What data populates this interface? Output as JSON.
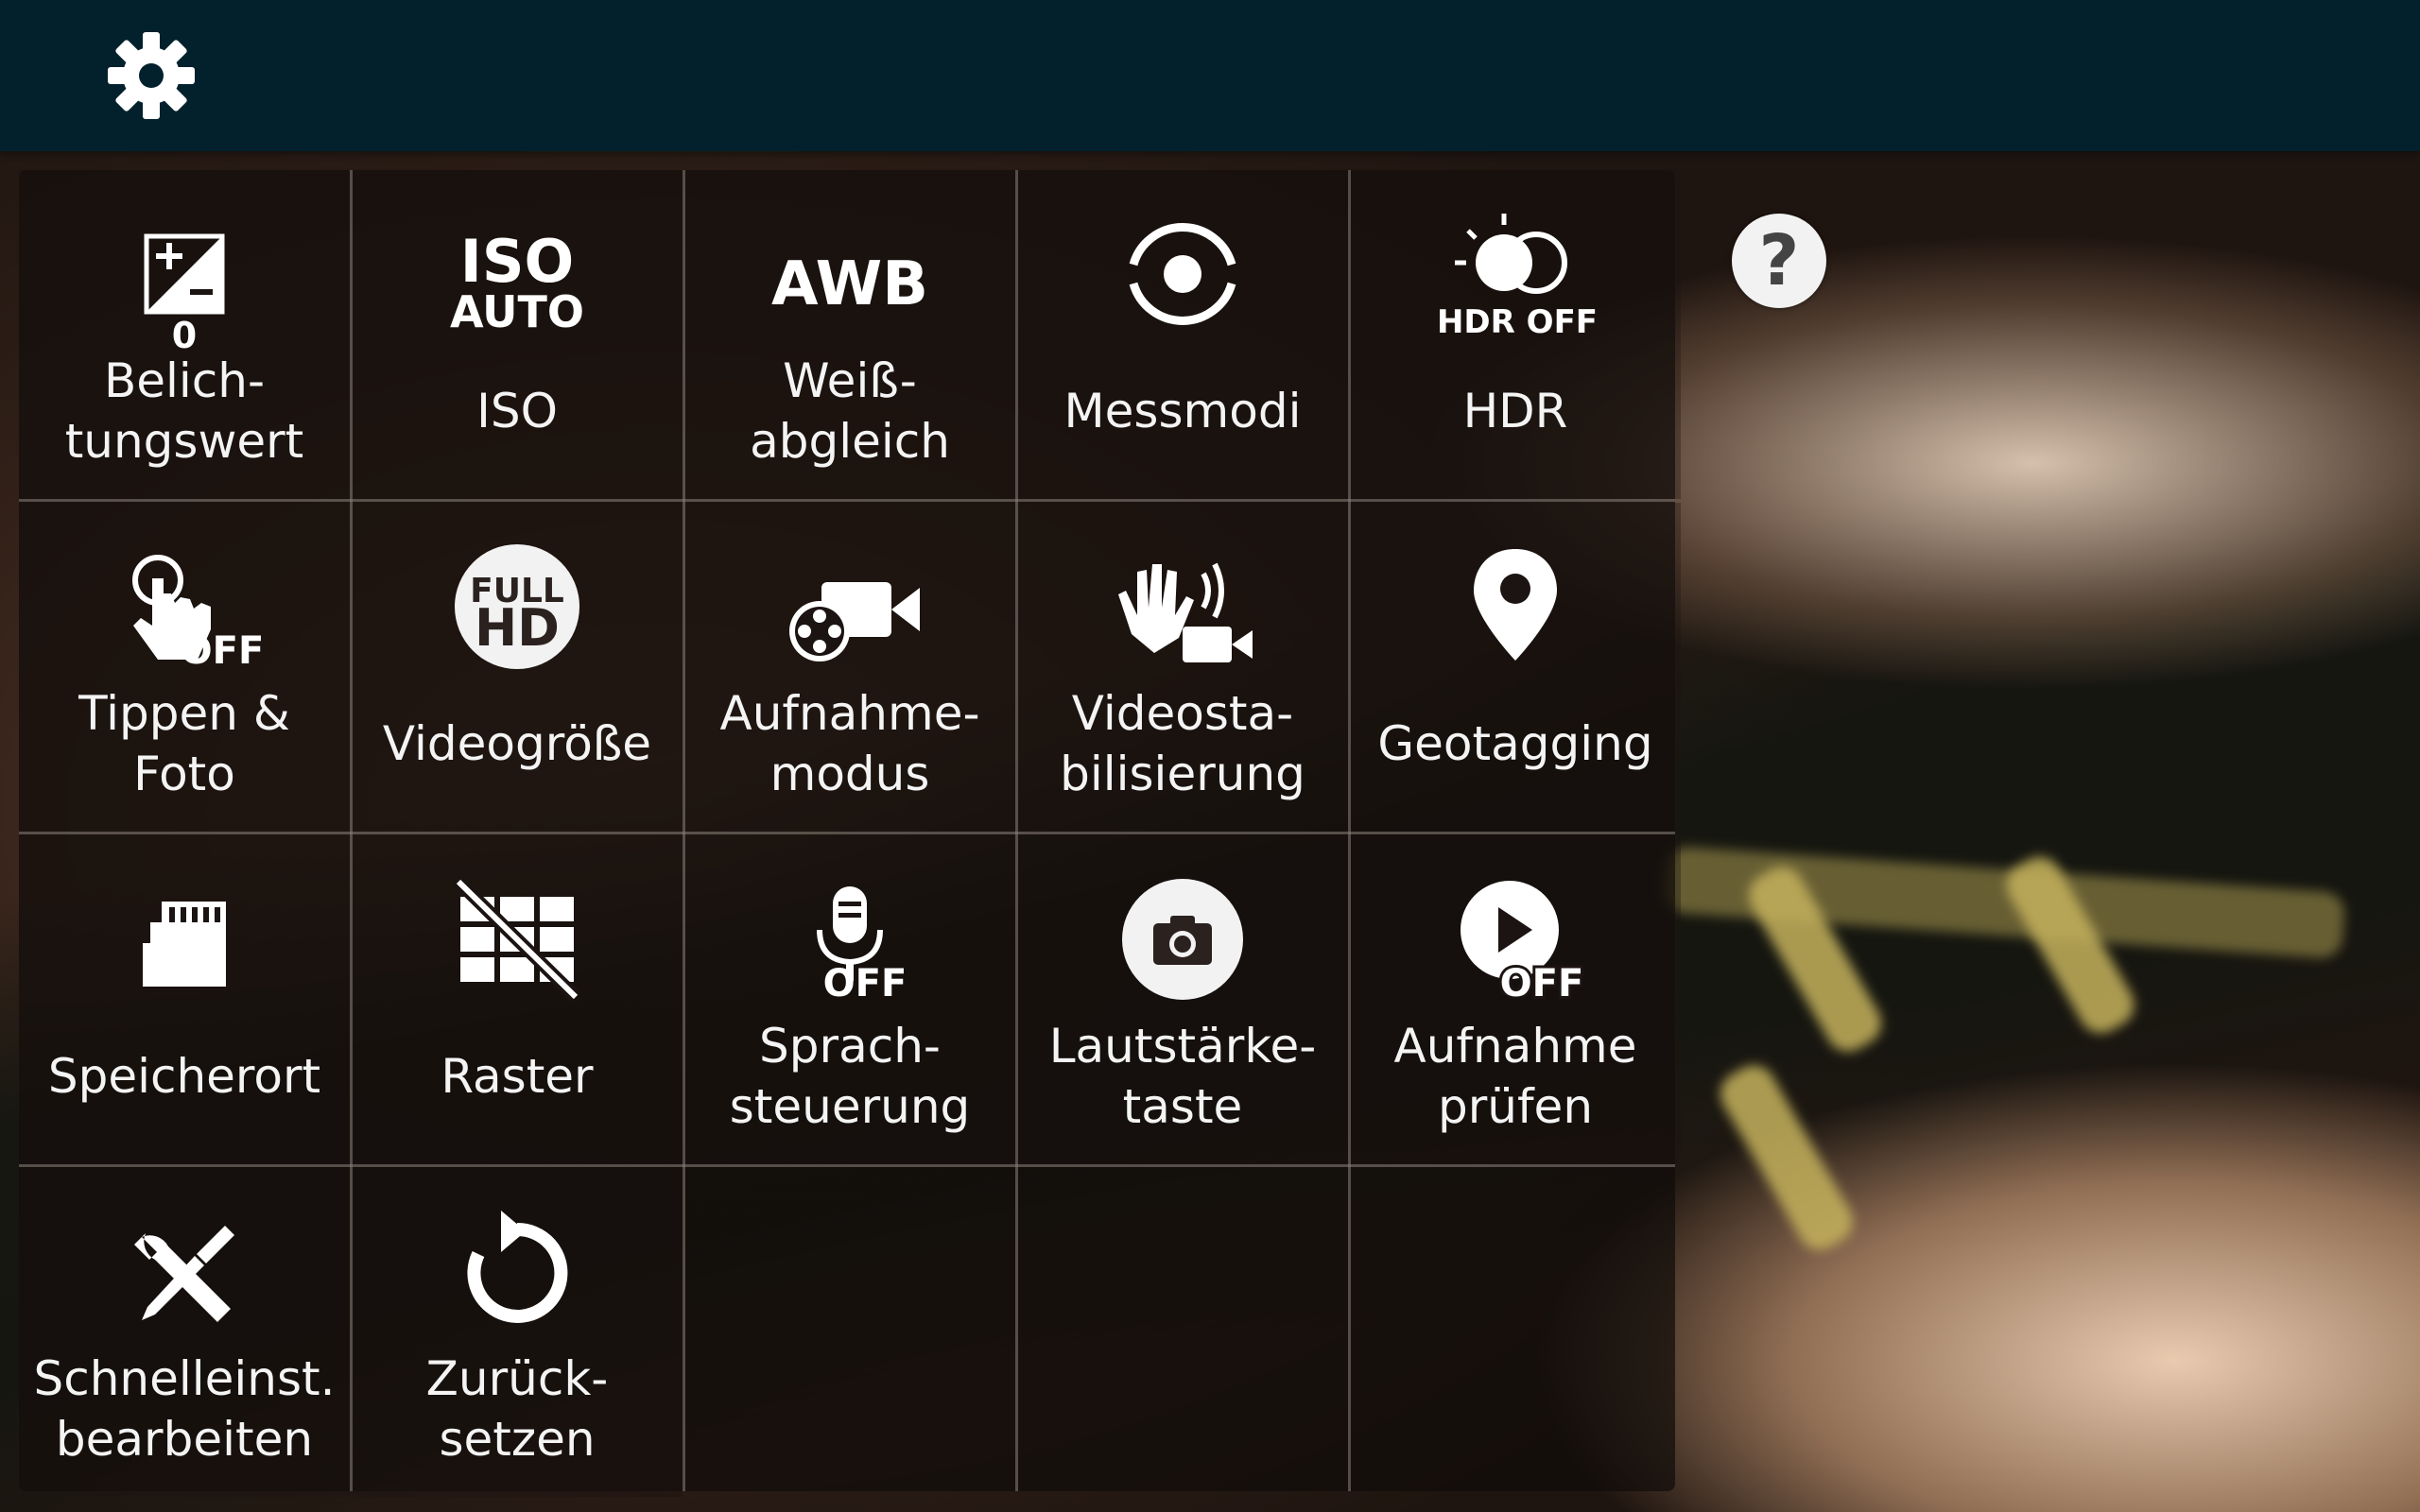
{
  "top_bar": {
    "settings_icon": "gear-icon"
  },
  "help": {
    "label": "?"
  },
  "menu": {
    "items": [
      {
        "key": "exposure",
        "icon": "exposure-value-icon",
        "value": "0",
        "label": "Belich-\ntungswert"
      },
      {
        "key": "iso",
        "icon": "iso-auto-icon",
        "icon_top": "ISO",
        "icon_bottom": "AUTO",
        "label": "ISO"
      },
      {
        "key": "wb",
        "icon": "awb-icon",
        "icon_text": "AWB",
        "label": "Weiß-\nabgleich"
      },
      {
        "key": "metering",
        "icon": "metering-icon",
        "label": "Messmodi"
      },
      {
        "key": "hdr",
        "icon": "hdr-icon",
        "icon_text": "HDR OFF",
        "label": "HDR"
      },
      {
        "key": "tap",
        "icon": "tap-to-shoot-icon",
        "icon_text": "OFF",
        "label": "Tippen & Foto"
      },
      {
        "key": "video_size",
        "icon": "full-hd-icon",
        "icon_top": "FULL",
        "icon_bottom": "HD",
        "label": "Videogröße"
      },
      {
        "key": "recording_mode",
        "icon": "recording-mode-icon",
        "label": "Aufnahme-\nmodus"
      },
      {
        "key": "stabilization",
        "icon": "video-stabilization-icon",
        "label": "Videosta-\nbilisierung"
      },
      {
        "key": "geotagging",
        "icon": "location-pin-icon",
        "label": "Geotagging"
      },
      {
        "key": "storage",
        "icon": "sd-card-icon",
        "label": "Speicherort"
      },
      {
        "key": "grid",
        "icon": "grid-off-icon",
        "label": "Raster"
      },
      {
        "key": "voice",
        "icon": "voice-control-icon",
        "icon_text": "OFF",
        "label": "Sprach-\nsteuerung"
      },
      {
        "key": "volume_key",
        "icon": "camera-key-icon",
        "label": "Lautstärke-\ntaste"
      },
      {
        "key": "review",
        "icon": "review-play-icon",
        "icon_text": "OFF",
        "label": "Aufnahme\nprüfen"
      },
      {
        "key": "edit_shortcuts",
        "icon": "tools-icon",
        "label": "Schnelleinst.\nbearbeiten"
      },
      {
        "key": "reset",
        "icon": "reset-icon",
        "label": "Zurück-\nsetzen"
      }
    ]
  }
}
